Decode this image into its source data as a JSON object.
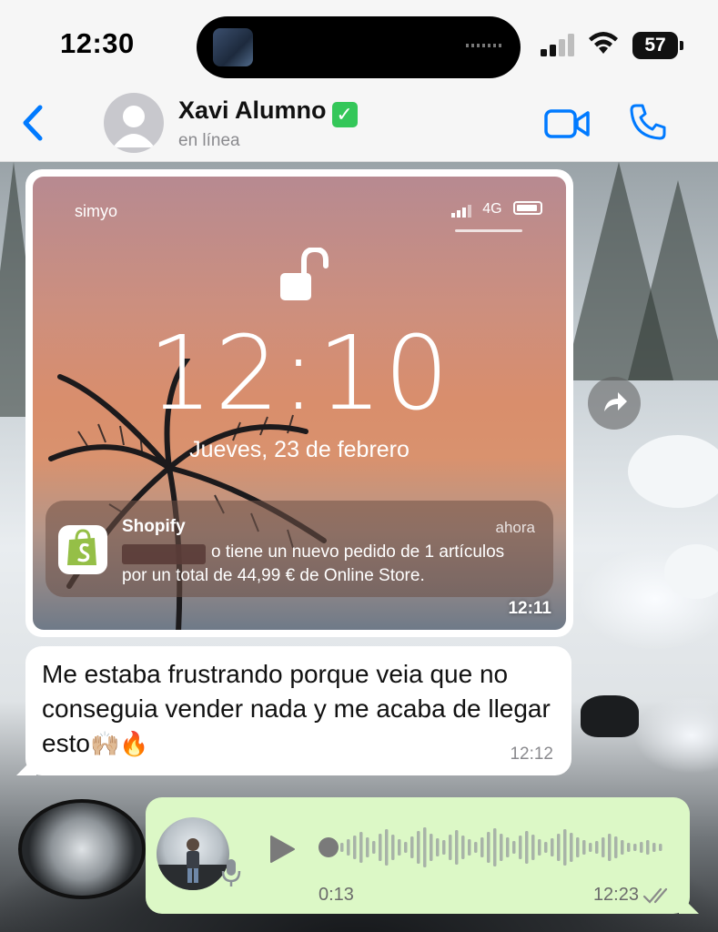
{
  "status_bar": {
    "time": "12:30",
    "battery": "57"
  },
  "header": {
    "contact_name": "Xavi Alumno",
    "verified_badge": "✅",
    "status": "en línea",
    "icons": [
      "chevron-left-icon",
      "avatar",
      "video-camera-icon",
      "phone-icon"
    ],
    "accent_color": "#007aff"
  },
  "image_message": {
    "lockscreen": {
      "carrier": "simyo",
      "network": "4G",
      "time": "12:10",
      "date": "Jueves, 23 de febrero",
      "notification": {
        "app": "Shopify",
        "time": "ahora",
        "body_line1": "o tiene un nuevo pedido de 1 artículos",
        "body_line2": "por un total de 44,99 € de Online Store."
      }
    },
    "timestamp": "12:11"
  },
  "text_message": {
    "text": "Me estaba frustrando porque veia que no conseguia vender nada y me acaba de llegar esto",
    "emoji": "🙌🏼🔥",
    "timestamp": "12:12"
  },
  "voice_message": {
    "duration": "0:13",
    "timestamp": "12:23",
    "bubble_color": "#dcf8c6"
  }
}
